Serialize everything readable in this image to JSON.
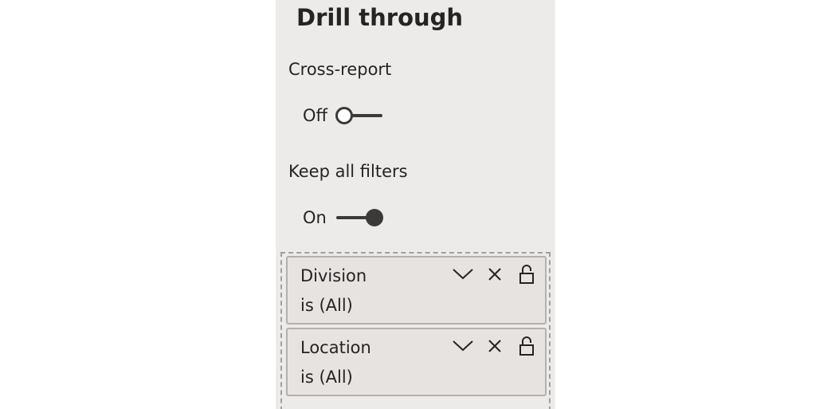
{
  "drill_through": {
    "title": "Drill through",
    "cross_report": {
      "label": "Cross-report",
      "state_text": "Off",
      "enabled": false
    },
    "keep_all_filters": {
      "label": "Keep all filters",
      "state_text": "On",
      "enabled": true
    },
    "filters": [
      {
        "field": "Division",
        "condition": "is (All)"
      },
      {
        "field": "Location",
        "condition": "is (All)"
      }
    ]
  },
  "icons": {
    "expand": "chevron-down-icon",
    "remove": "close-icon",
    "lock": "unlocked-padlock-icon"
  },
  "colors": {
    "panel_background": "#edebe9",
    "card_background": "#e6e3e1",
    "toggle_color": "#3b3a39",
    "text": "#252423"
  }
}
